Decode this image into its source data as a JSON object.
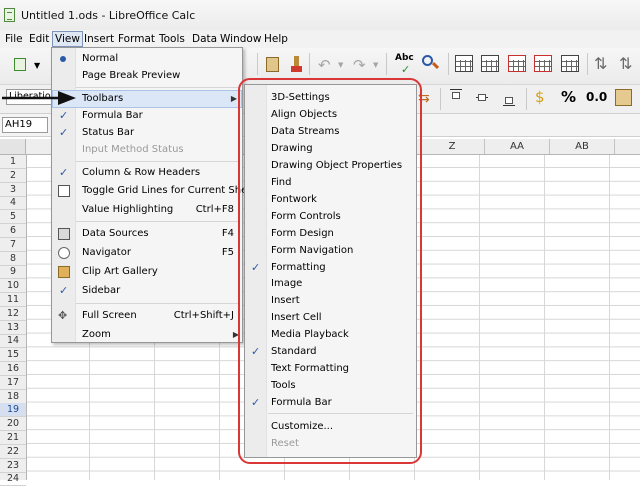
{
  "window": {
    "title": "Untitled 1.ods - LibreOffice Calc"
  },
  "menubar": [
    "File",
    "Edit",
    "View",
    "Insert",
    "Format",
    "Tools",
    "Data",
    "Window",
    "Help"
  ],
  "toolbar2": {
    "font_name": "Liberatio",
    "percent": "%",
    "decimal": "0.0"
  },
  "formula": {
    "cell_ref": "AH19"
  },
  "sheet": {
    "columns": [
      "Z",
      "AA",
      "AB"
    ],
    "rows": [
      "1",
      "2",
      "3",
      "4",
      "5",
      "6",
      "7",
      "8",
      "9",
      "10",
      "11",
      "12",
      "13",
      "14",
      "15",
      "16",
      "17",
      "18",
      "19",
      "20",
      "21",
      "22",
      "23",
      "24"
    ],
    "selected_row": "19"
  },
  "view_menu": {
    "normal": "Normal",
    "page_break_preview": "Page Break Preview",
    "toolbars": "Toolbars",
    "formula_bar": "Formula Bar",
    "status_bar": "Status Bar",
    "input_method_status": "Input Method Status",
    "column_row_headers": "Column & Row Headers",
    "toggle_grid_lines": "Toggle Grid Lines for Current Sheet",
    "value_highlighting": "Value Highlighting",
    "value_highlighting_shortcut": "Ctrl+F8",
    "data_sources": "Data Sources",
    "data_sources_shortcut": "F4",
    "navigator": "Navigator",
    "navigator_shortcut": "F5",
    "clip_art_gallery": "Clip Art Gallery",
    "sidebar": "Sidebar",
    "full_screen": "Full Screen",
    "full_screen_shortcut": "Ctrl+Shift+J",
    "zoom": "Zoom"
  },
  "toolbars_menu": {
    "items": [
      "3D-Settings",
      "Align Objects",
      "Data Streams",
      "Drawing",
      "Drawing Object Properties",
      "Find",
      "Fontwork",
      "Form Controls",
      "Form Design",
      "Form Navigation",
      "Formatting",
      "Image",
      "Insert",
      "Insert Cell",
      "Media Playback",
      "Standard",
      "Text Formatting",
      "Tools",
      "Formula Bar"
    ],
    "checked": [
      "Formatting",
      "Standard",
      "Formula Bar"
    ],
    "customize": "Customize...",
    "reset": "Reset"
  },
  "colors": {
    "highlight_outline": "#d93636",
    "check": "#2a5aa5",
    "menu_hover": "#dbe6f6"
  }
}
